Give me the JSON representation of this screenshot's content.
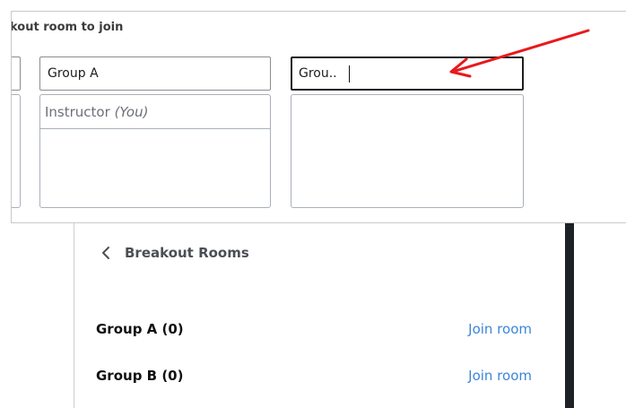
{
  "assignment": {
    "heading": "kout room to join",
    "columns": [
      {
        "name_value": "",
        "members": []
      },
      {
        "name_value": "Group A",
        "members": [
          {
            "name": "Instructor",
            "suffix": "(You)"
          }
        ]
      },
      {
        "name_value": "Grou..",
        "members": []
      }
    ]
  },
  "annotation": {
    "arrow_color": "#e8191c"
  },
  "rooms": {
    "back_label": "Breakout Rooms",
    "items": [
      {
        "name": "Group A",
        "count": "(0)",
        "join_label": "Join room"
      },
      {
        "name": "Group B",
        "count": "(0)",
        "join_label": "Join room"
      }
    ],
    "link_color": "#3a86d9"
  }
}
